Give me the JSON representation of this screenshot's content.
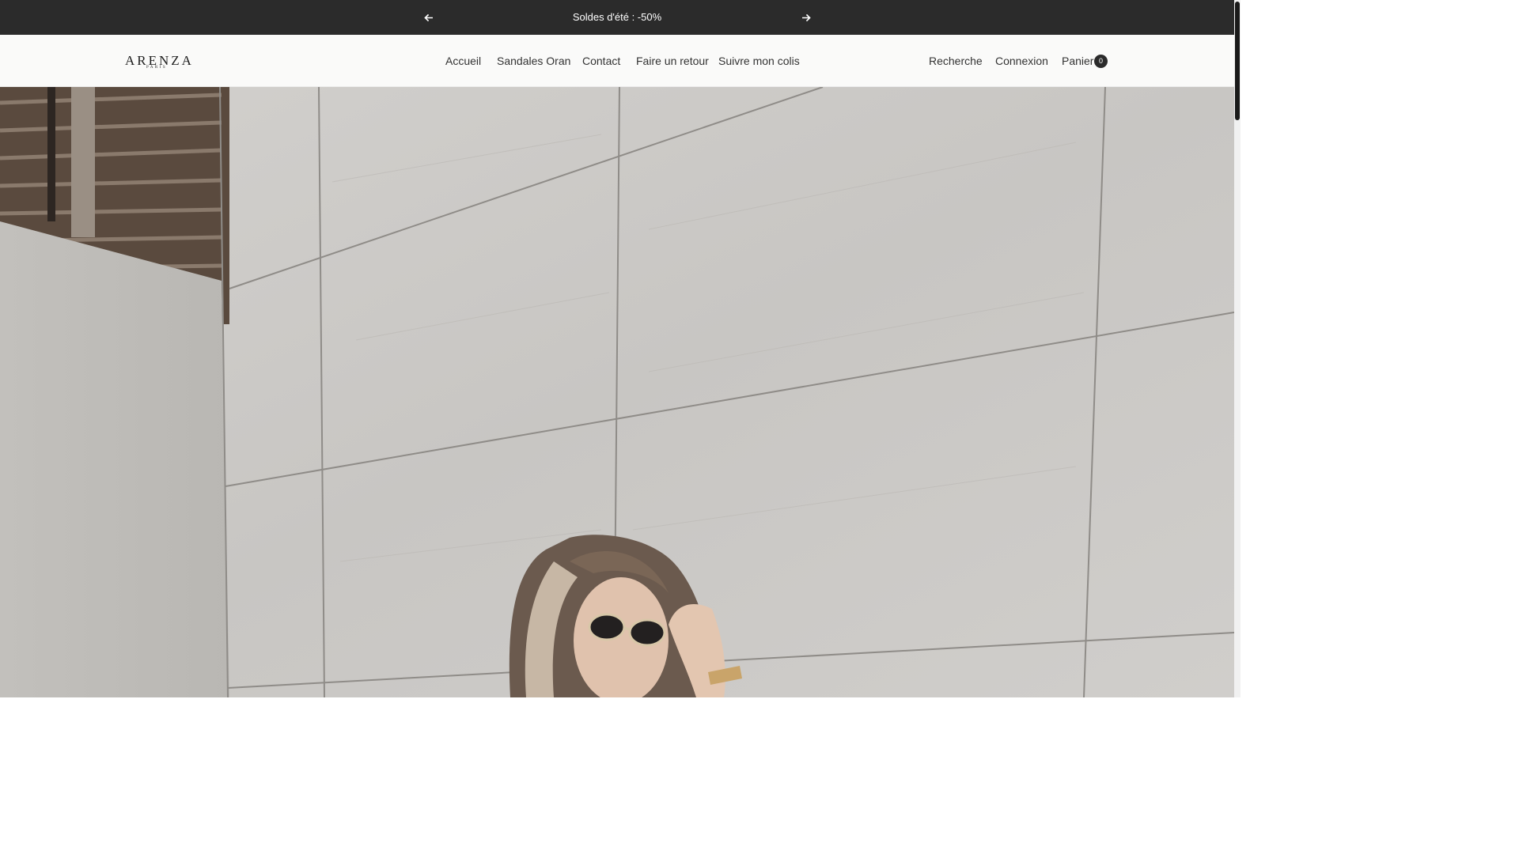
{
  "announcement": {
    "message": "Soldes d'été : -50%",
    "prev_icon": "arrow-left-icon",
    "next_icon": "arrow-right-icon"
  },
  "brand": {
    "name": "ARENZA",
    "tagline": "PARIS"
  },
  "nav": {
    "items": [
      "Accueil",
      "Sandales Oran",
      "Contact",
      "Faire un retour",
      "Suivre mon colis"
    ]
  },
  "header_actions": {
    "search": "Recherche",
    "login": "Connexion",
    "cart": "Panier",
    "cart_count": "0"
  },
  "colors": {
    "announcement_bg": "#2b2b2b",
    "header_bg": "#fafaf9",
    "text": "#333333"
  }
}
